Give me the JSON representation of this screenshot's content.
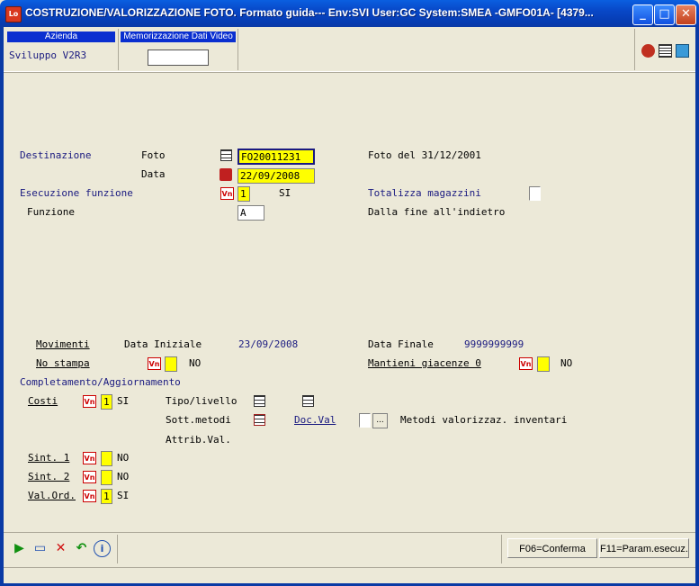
{
  "window": {
    "title": "COSTRUZIONE/VALORIZZAZIONE FOTO.  Formato guida--- Env:SVI User:GC System:SMEA -GMFO01A- [4379...",
    "icon_text": "Lo",
    "controls": {
      "minimize": "_",
      "maximize": "□",
      "close": "✕"
    }
  },
  "header": {
    "azienda_caption": "Azienda",
    "azienda_value": "Sviluppo V2R3",
    "memo_caption": "Memorizzazione Dati Video",
    "memo_value": ""
  },
  "form": {
    "destinazione_label": "Destinazione",
    "foto_label": "Foto",
    "foto_value": "FO20011231",
    "foto_desc": "Foto del 31/12/2001",
    "data_label": "Data",
    "data_value": "22/09/2008",
    "esecuzione_label": "Esecuzione funzione",
    "esecuzione_value": "1",
    "esecuzione_desc": "SI",
    "totalizza_label": "Totalizza magazzini",
    "funzione_label": "Funzione",
    "funzione_value": "A",
    "funzione_desc": "Dalla fine all'indietro",
    "movimenti_label": "Movimenti",
    "data_iniziale_label": "Data Iniziale",
    "data_iniziale_value": "23/09/2008",
    "data_finale_label": "Data Finale",
    "data_finale_value": "9999999999",
    "no_stampa_label": "No stampa",
    "no_stampa_desc": "NO",
    "mantieni_label": "Mantieni giacenze 0",
    "mantieni_desc": "NO",
    "completamento_label": "Completamento/Aggiornamento",
    "costi_label": "Costi",
    "costi_value": "1",
    "costi_desc": "SI",
    "tipo_livello_label": "Tipo/livello",
    "sott_metodi_label": "Sott.metodi",
    "doc_val_label": "Doc.Val",
    "dots_label": "...",
    "metodi_desc": "Metodi valorizzaz. inventari",
    "attrib_val_label": "Attrib.Val.",
    "sint1_label": "Sint. 1",
    "sint1_desc": "NO",
    "sint2_label": "Sint. 2",
    "sint2_desc": "NO",
    "valord_label": "Val.Ord.",
    "valord_value": "1",
    "valord_desc": "SI",
    "vn_icon_text": "Vn"
  },
  "footer": {
    "f06_label": "F06=Conferma",
    "f11_label": "F11=Param.esecuz."
  },
  "colors": {
    "title_bar": "#0a5fe0",
    "field_yellow": "#ffff00",
    "label_blue": "#1a1a80",
    "background": "#ece9d8"
  }
}
